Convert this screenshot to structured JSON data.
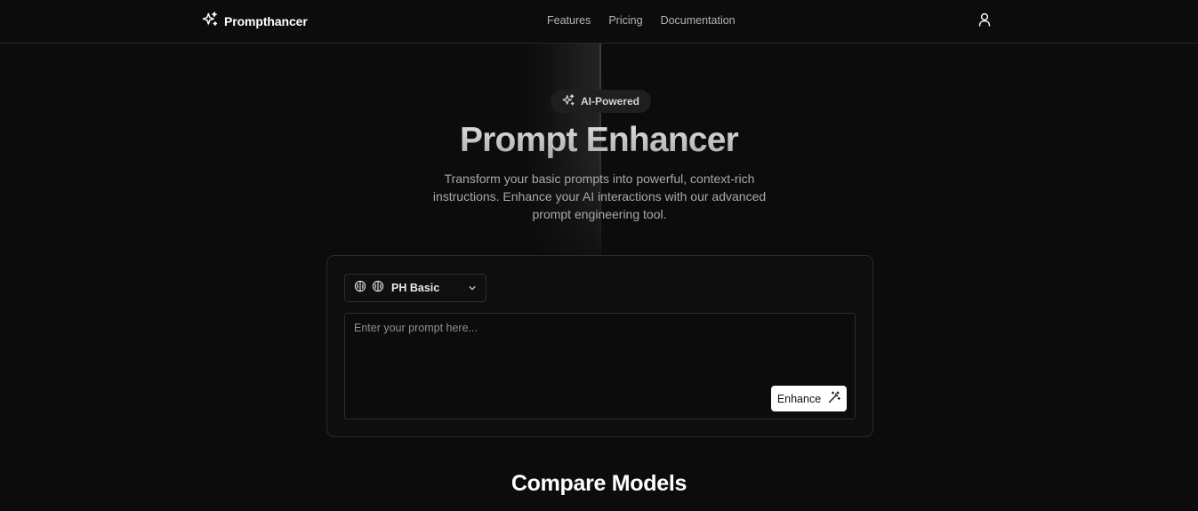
{
  "header": {
    "brand": "Prompthancer",
    "nav": [
      "Features",
      "Pricing",
      "Documentation"
    ]
  },
  "hero": {
    "badge": "AI-Powered",
    "title": "Prompt Enhancer",
    "subtitle": "Transform your basic prompts into powerful, context-rich instructions. Enhance your AI interactions with our advanced prompt engineering tool."
  },
  "editor": {
    "model_select": "PH Basic",
    "prompt_placeholder": "Enter your prompt here...",
    "prompt_value": "",
    "enhance_label": "Enhance"
  },
  "compare": {
    "title": "Compare Models"
  },
  "icons": {
    "brand": "sparkles-icon",
    "badge": "sparkles-icon",
    "user": "user-icon",
    "model": "brain-icon",
    "chevron": "chevron-down-icon",
    "enhance": "wand-icon"
  },
  "colors": {
    "background": "#0c0c0c",
    "accent_button": "#ffffff",
    "border": "#2b2b2b"
  }
}
